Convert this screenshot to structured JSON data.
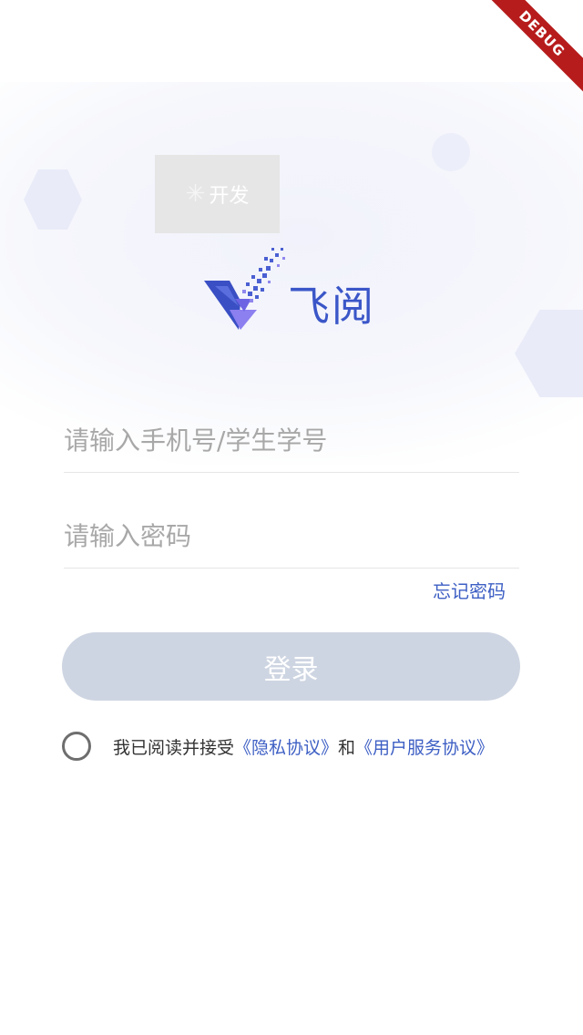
{
  "debug_banner": {
    "label": "DEBUG",
    "color": "#b71c1c"
  },
  "env_badge": {
    "label": "开发"
  },
  "logo": {
    "name": "v-logo-icon",
    "text": "飞阅",
    "brand_color": "#3a56c8"
  },
  "form": {
    "account_placeholder": "请输入手机号/学生学号",
    "password_placeholder": "请输入密码",
    "forgot_label": "忘记密码"
  },
  "login": {
    "label": "登录",
    "bg_color": "#ced5e2"
  },
  "agreement": {
    "prefix": "我已阅读并接受",
    "privacy_link": "《隐私协议》",
    "conjunction": "和",
    "service_link": "《用户服务协议》",
    "link_color": "#3d5fc4"
  }
}
